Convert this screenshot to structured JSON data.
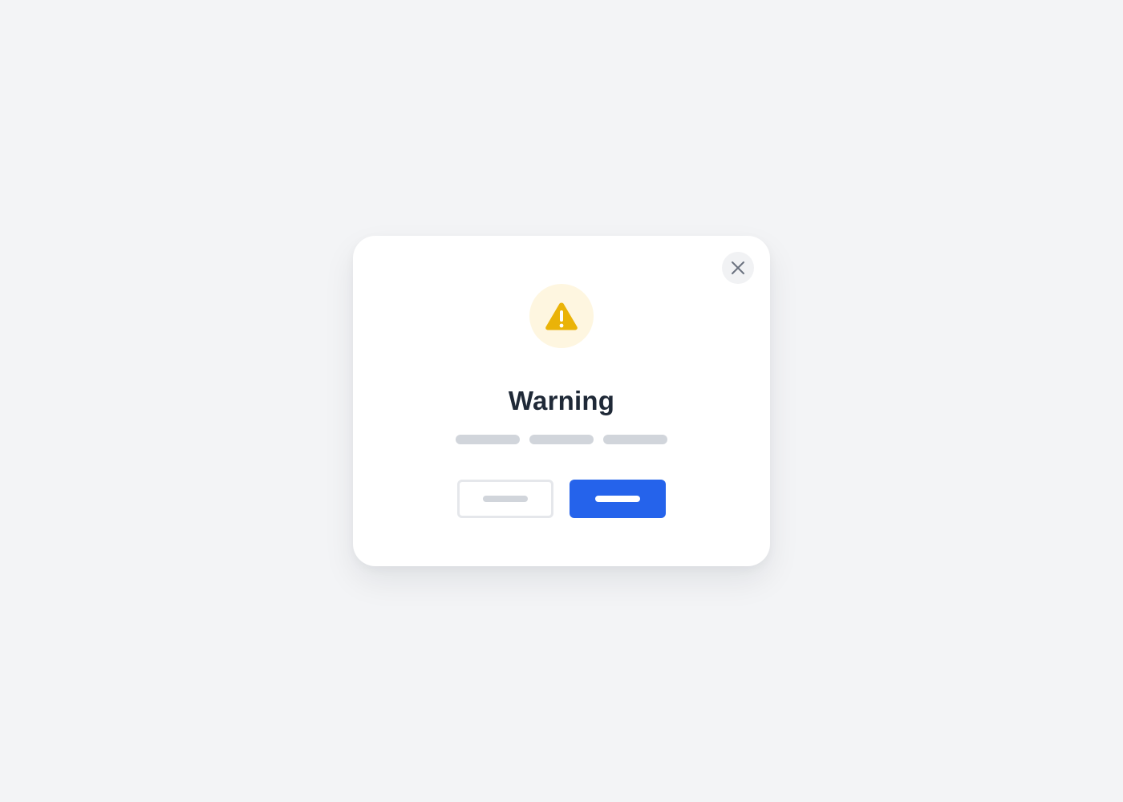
{
  "dialog": {
    "title": "Warning",
    "icon": "warning-triangle-icon",
    "close_icon": "close-icon",
    "description_placeholder_count": 3,
    "buttons": {
      "secondary": {
        "label_placeholder": true
      },
      "primary": {
        "label_placeholder": true
      }
    }
  },
  "colors": {
    "page_background": "#f3f4f6",
    "dialog_background": "#ffffff",
    "warning": "#eab308",
    "warning_soft": "#fef6e0",
    "close_background": "#f1f2f4",
    "close_glyph": "#6b7280",
    "title": "#1f2937",
    "placeholder": "#d1d5db",
    "secondary_border": "#e5e7eb",
    "secondary_label": "#d1d5db",
    "primary": "#2563eb",
    "primary_label": "#ffffff"
  }
}
